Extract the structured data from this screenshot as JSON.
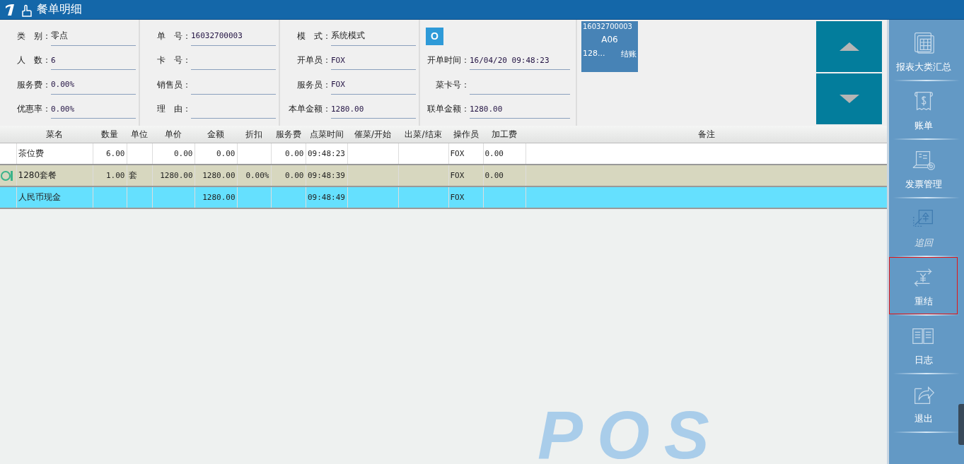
{
  "window": {
    "title": "餐单明细"
  },
  "info_columns": [
    [
      {
        "kind": "field",
        "label": "类　别：",
        "value": "零点"
      },
      {
        "kind": "field",
        "label": "人　数：",
        "value": "6"
      },
      {
        "kind": "field",
        "label": "服务费：",
        "value": "0.00%"
      },
      {
        "kind": "field",
        "label": "优惠率：",
        "value": "0.00%"
      }
    ],
    [
      {
        "kind": "field",
        "label": "单　号：",
        "value": "16032700003"
      },
      {
        "kind": "field",
        "label": "卡　号："
      },
      {
        "kind": "field",
        "label": "销售员："
      },
      {
        "kind": "field",
        "label": "理　由："
      }
    ],
    [
      {
        "kind": "field",
        "label": "模　式：",
        "value": "系统模式"
      },
      {
        "kind": "field",
        "label": "开单员：",
        "value": "FOX"
      },
      {
        "kind": "field",
        "label": "服务员：",
        "value": "FOX"
      },
      {
        "kind": "field",
        "label": "本单金额：",
        "value": "1280.00"
      }
    ],
    [
      {
        "kind": "button",
        "label": "O"
      },
      {
        "kind": "field",
        "label": "开单时间：",
        "value": "16/04/20 09:48:23"
      },
      {
        "kind": "field",
        "label": "菜卡号："
      },
      {
        "kind": "field",
        "label": "联单金额：",
        "value": "1280.00"
      }
    ]
  ],
  "table_card": {
    "number": "16032700003",
    "table": "A06",
    "amount": "128...",
    "action": "结账"
  },
  "table": {
    "columns": [
      "菜名",
      "数量",
      "单位",
      "单价",
      "金额",
      "折扣",
      "服务费",
      "点菜时间",
      "催菜/开始",
      "出菜/结束",
      "操作员",
      "加工费",
      "备注"
    ],
    "rows": [
      {
        "current": false,
        "selected": false,
        "cells": [
          "茶位费",
          "6.00",
          "",
          "0.00",
          "0.00",
          "",
          "0.00",
          "09:48:23",
          "",
          "",
          "FOX",
          "0.00",
          ""
        ]
      },
      {
        "current": true,
        "selected": false,
        "cells": [
          "1280套餐",
          "1.00",
          "套",
          "1280.00",
          "1280.00",
          "0.00%",
          "0.00",
          "09:48:39",
          "",
          "",
          "FOX",
          "0.00",
          ""
        ]
      },
      {
        "current": false,
        "selected": true,
        "cells": [
          "人民币现金",
          "",
          "",
          "",
          "1280.00",
          "",
          "",
          "09:48:49",
          "",
          "",
          "FOX",
          "",
          ""
        ]
      }
    ]
  },
  "background_logo": "POS",
  "sidebar": {
    "items": [
      {
        "label": "报表大类汇总",
        "disabled": false,
        "selected": false
      },
      {
        "label": "账单",
        "disabled": false,
        "selected": false
      },
      {
        "label": "发票管理",
        "disabled": false,
        "selected": false
      },
      {
        "label": "追回",
        "disabled": true,
        "selected": false
      },
      {
        "label": "重结",
        "disabled": false,
        "selected": true
      },
      {
        "label": "日志",
        "disabled": false,
        "selected": false
      },
      {
        "label": "退出",
        "disabled": false,
        "selected": false
      }
    ]
  }
}
